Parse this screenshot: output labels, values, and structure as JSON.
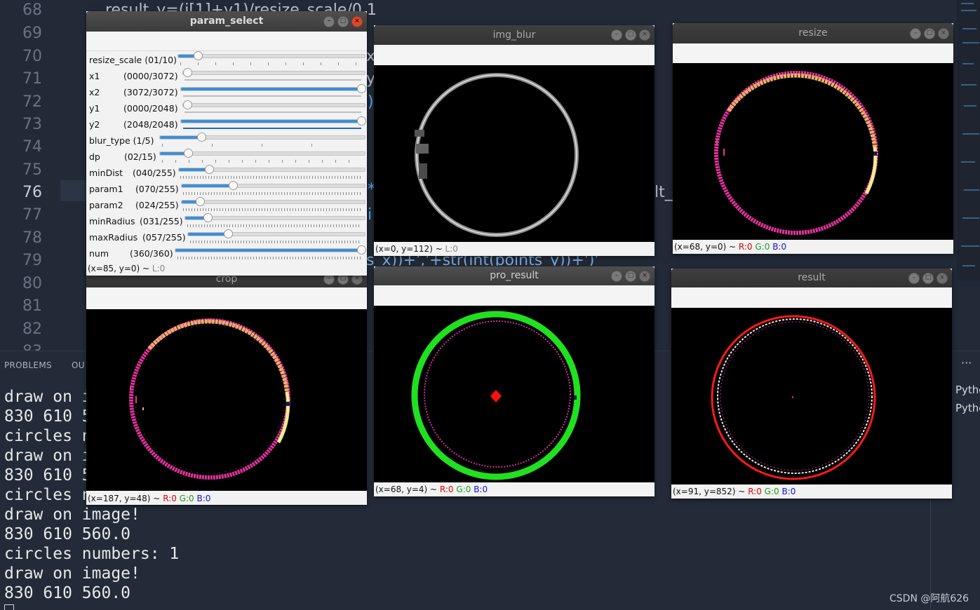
{
  "editor": {
    "line_numbers": [
      "68",
      "69",
      "70",
      "71",
      "72",
      "73",
      "74",
      "75",
      "76",
      "77",
      "78",
      "79",
      "80",
      "81",
      "82",
      "83"
    ],
    "active_line": "76",
    "fragments": [
      {
        "id": "f68",
        "text": "result_y=(i[1]+y1)/resize_scale/0.1"
      },
      {
        "id": "f70",
        "text": "x"
      },
      {
        "id": "f71",
        "text": "y"
      },
      {
        "id": "f72",
        "text": ")"
      },
      {
        "id": "f76a",
        "text": "*"
      },
      {
        "id": "f76b",
        "text": "lt_"
      },
      {
        "id": "f77",
        "text": "i"
      },
      {
        "id": "f79",
        "text": "s_x))+','+str(int(points_y))+')'"
      }
    ]
  },
  "panel": {
    "tabs": [
      "PROBLEMS",
      "OU"
    ],
    "more": "···",
    "terminal_lines": [
      "draw on i",
      "830 610 5",
      "circles n",
      "draw on i",
      "830 610 5",
      "circles n",
      "draw on image!",
      "830 610 560.0",
      "circles numbers: 1",
      "draw on image!",
      "830 610 560.0"
    ],
    "side_items": [
      "Pytho",
      "Pytho"
    ],
    "watermark": "CSDN @阿航626"
  },
  "windows": {
    "param_select": {
      "title": "param_select",
      "status": "(x=85, y=0) ~",
      "status_l": "L:0",
      "sliders": [
        {
          "name": "resize_scale",
          "label": "resize_scale (01/10)",
          "value": 1,
          "max": 10
        },
        {
          "name": "x1",
          "label": "x1",
          "value_text": "(0000/3072)",
          "value": 0,
          "max": 3072
        },
        {
          "name": "x2",
          "label": "x2",
          "value_text": "(3072/3072)",
          "value": 3072,
          "max": 3072
        },
        {
          "name": "y1",
          "label": "y1",
          "value_text": "(0000/2048)",
          "value": 0,
          "max": 2048
        },
        {
          "name": "y2",
          "label": "y2",
          "value_text": "(2048/2048)",
          "value": 2048,
          "max": 2048
        },
        {
          "name": "blur_type",
          "label": "blur_type  (1/5)",
          "value": 1,
          "max": 5
        },
        {
          "name": "dp",
          "label": "dp",
          "value_text": "(02/15)",
          "value": 2,
          "max": 15
        },
        {
          "name": "minDist",
          "label": "minDist",
          "value_text": "(040/255)",
          "value": 40,
          "max": 255
        },
        {
          "name": "param1",
          "label": "param1",
          "value_text": "(070/255)",
          "value": 70,
          "max": 255
        },
        {
          "name": "param2",
          "label": "param2",
          "value_text": "(024/255)",
          "value": 24,
          "max": 255
        },
        {
          "name": "minRadius",
          "label": "minRadius",
          "value_text": "(031/255)",
          "value": 31,
          "max": 255
        },
        {
          "name": "maxRadius",
          "label": "maxRadius",
          "value_text": "(057/255)",
          "value": 57,
          "max": 255
        },
        {
          "name": "num",
          "label": "num",
          "value_text": "(360/360)",
          "value": 360,
          "max": 360
        }
      ]
    },
    "img_blur": {
      "title": "img_blur",
      "status": "(x=0, y=112) ~",
      "status_l": "L:0"
    },
    "resize": {
      "title": "resize",
      "status": "(x=68, y=0) ~",
      "r": "R:0",
      "g": "G:0",
      "b": "B:0"
    },
    "crop": {
      "title": "crop",
      "status": "(x=187, y=48) ~",
      "r": "R:0",
      "g": "G:0",
      "b": "B:0"
    },
    "pro_result": {
      "title": "pro_result",
      "status": "(x=68, y=4) ~",
      "r": "R:0",
      "g": "G:0",
      "b": "B:0"
    },
    "result": {
      "title": "result",
      "status": "(x=91, y=852) ~",
      "r": "R:0",
      "g": "G:0",
      "b": "B:0"
    }
  },
  "colors": {
    "slider_fill": "#3d8fd6",
    "close_button": "#d74a2c",
    "editor_bg": "#222a37"
  }
}
